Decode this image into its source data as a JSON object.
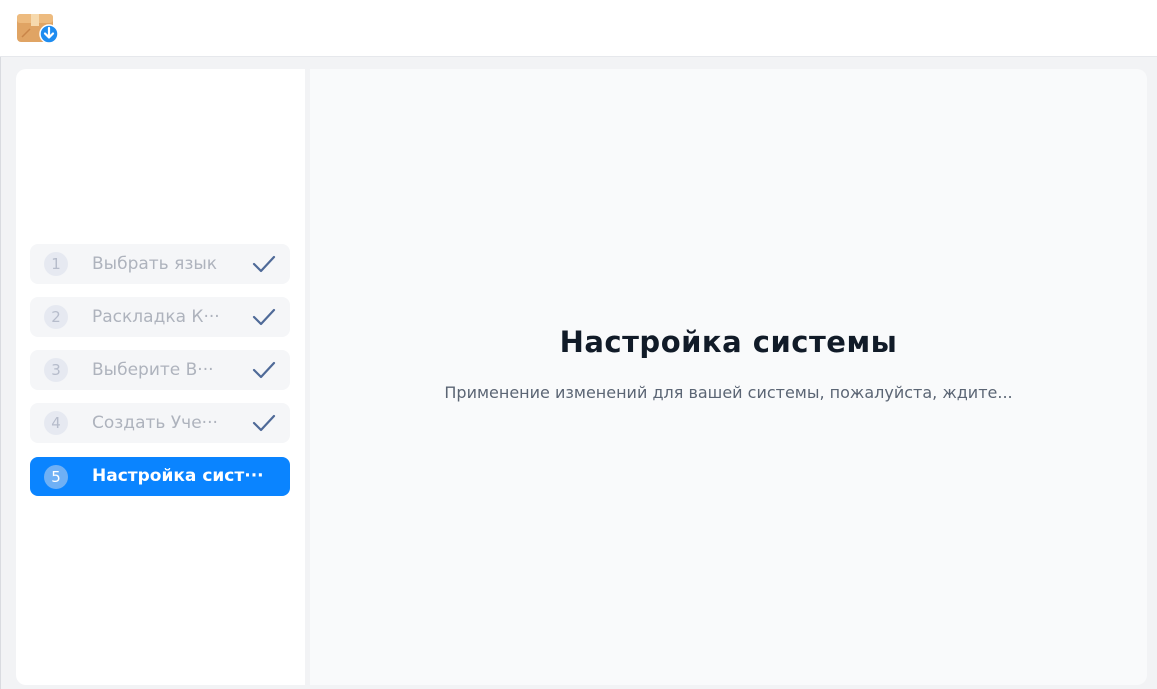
{
  "app": {
    "icon": "installer-box-download-icon"
  },
  "steps": [
    {
      "number": "1",
      "label": "Выбрать язык",
      "state": "done"
    },
    {
      "number": "2",
      "label": "Раскладка К···",
      "state": "done"
    },
    {
      "number": "3",
      "label": "Выберите В···",
      "state": "done"
    },
    {
      "number": "4",
      "label": "Создать Уче···",
      "state": "done"
    },
    {
      "number": "5",
      "label": "Настройка сист···",
      "state": "active"
    }
  ],
  "main": {
    "title": "Настройка системы",
    "subtitle": "Применение изменений для вашей системы, пожалуйста, ждите..."
  },
  "colors": {
    "accent": "#0a84ff",
    "check": "#4f6a98",
    "title": "#111b28"
  }
}
